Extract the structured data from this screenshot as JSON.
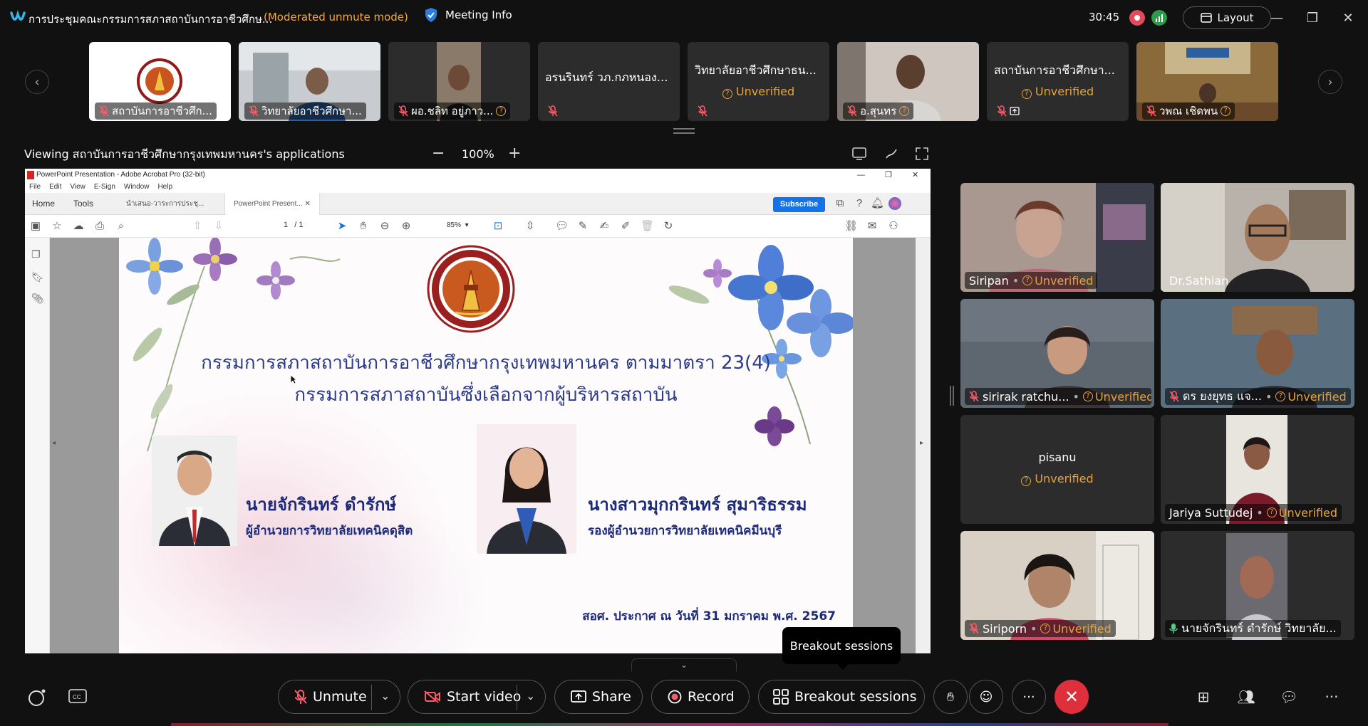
{
  "titlebar": {
    "meeting_title": "การประชุมคณะกรรมการสภาสถาบันการอาชีวศึกษ...",
    "mode": "(Moderated unmute mode)",
    "meeting_info": "Meeting Info",
    "timer": "30:45",
    "layout_label": "Layout"
  },
  "thumbnails": [
    {
      "name": "",
      "footer": "สถาบันการอาชีวศึก...",
      "unverified": ""
    },
    {
      "name": "",
      "footer": "วิทยาลัยอาชีวศึกษา...",
      "unverified": ""
    },
    {
      "name": "",
      "footer": "ผอ.ชลิท อยู่ภาว...",
      "unverified": ""
    },
    {
      "name": "อรนรินทร์ วภ.กภหนองจ...",
      "footer": "",
      "unverified": ""
    },
    {
      "name": "วิทยาลัยอาชีวศึกษาธน...",
      "footer": "",
      "unverified": "Unverified"
    },
    {
      "name": "",
      "footer": "อ.สุนทร",
      "unverified": ""
    },
    {
      "name": "สถาบันการอาชีวศึกษา...",
      "footer": "",
      "unverified": "Unverified"
    },
    {
      "name": "",
      "footer": "วพณ เชิดพน",
      "unverified": ""
    }
  ],
  "share": {
    "viewing_label": "Viewing สถาบันการอาชีวศึกษากรุงเทพมหานคร's applications",
    "zoom": "100%"
  },
  "acrobat": {
    "window_title": "PowerPoint Presentation - Adobe Acrobat Pro (32-bit)",
    "menu": [
      "File",
      "Edit",
      "View",
      "E-Sign",
      "Window",
      "Help"
    ],
    "tab_home": "Home",
    "tab_tools": "Tools",
    "doc_tab_1": "นำเสนอ-วาระการประชุ...",
    "doc_tab_2": "PowerPoint Present...",
    "subscribe": "Subscribe",
    "page_current": "1",
    "page_total": "/ 1",
    "zoom": "85%"
  },
  "slide": {
    "title_line1": "กรรมการสภาสถาบันการอาชีวศึกษากรุงเทพมหานคร ตามมาตรา 23(4)",
    "title_line2": "กรรมการสภาสถาบันซึ่งเลือกจากผู้บริหารสถาบัน",
    "person1_name": "นายจักรินทร์ ดำรักษ์",
    "person1_role": "ผู้อำนวยการวิทยาลัยเทคนิคดุสิต",
    "person2_name": "นางสาวมุกกรินทร์ สุมาริธรรม",
    "person2_role": "รองผู้อำนวยการวิทยาลัยเทคนิคมีนบุรี",
    "announcement": "สอศ. ประกาศ ณ วันที่ 31 มกราคม พ.ศ. 2567"
  },
  "participants": [
    {
      "name": "Siripan",
      "status": "Unverified"
    },
    {
      "name": "Dr.Sathian",
      "status": ""
    },
    {
      "name": "sirirak ratchu...",
      "status": "Unverified"
    },
    {
      "name": "ดร ยงยุทธ แจ...",
      "status": "Unverified"
    },
    {
      "name": "pisanu",
      "status": "Unverified"
    },
    {
      "name": "Jariya Suttudej",
      "status": "Unverified"
    },
    {
      "name": "Siriporn",
      "status": "Unverified"
    },
    {
      "name": "นายจักรินทร์ ดำรักษ์ วิทยาลัย...",
      "status": ""
    }
  ],
  "controls": {
    "unmute": "Unmute",
    "start_video": "Start video",
    "share": "Share",
    "record": "Record",
    "breakout": "Breakout sessions",
    "tooltip": "Breakout sessions"
  },
  "colors": {
    "accent_unverified": "#e6a23c",
    "end_call": "#e02f3c",
    "active_speaker": "#2bb59a",
    "slide_text": "#2b3a8a"
  }
}
